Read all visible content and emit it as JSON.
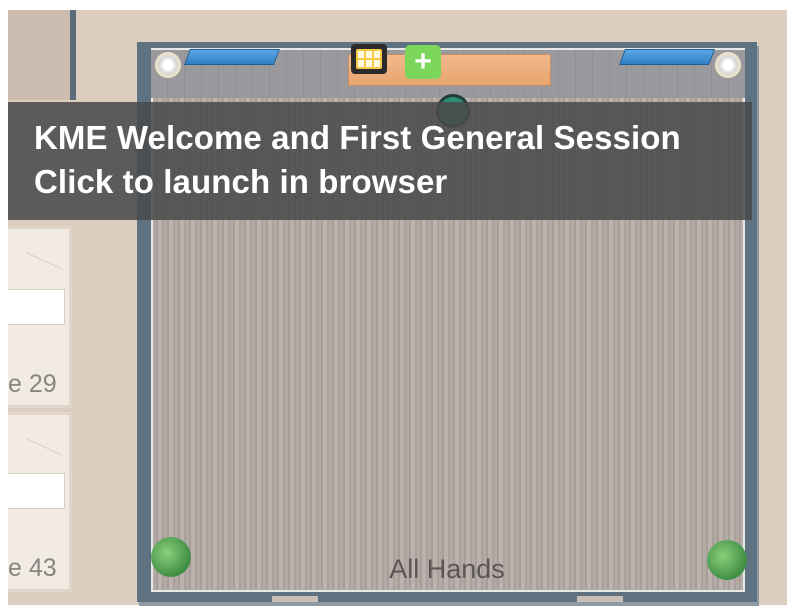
{
  "tooltip": {
    "title": "KME Welcome and First General Session",
    "subtitle": "Click to launch in browser"
  },
  "main_room": {
    "label": "All Hands"
  },
  "side_rooms": [
    {
      "number_label": "e 29"
    },
    {
      "number_label": "e 43"
    }
  ],
  "icons": {
    "monitor": "monitor-icon",
    "plus": "plus-icon",
    "avatar": "avatar",
    "plant": "plant-icon",
    "lamp": "lamp-icon"
  },
  "colors": {
    "ground": "#dccdbf",
    "wall": "#5e7282",
    "floor": "#b3aaa6",
    "desk": "#f3b98a",
    "screen_panel": "#5aa7e6",
    "plus_button": "#7dd65c",
    "tooltip_bg": "#4b4b4b"
  }
}
